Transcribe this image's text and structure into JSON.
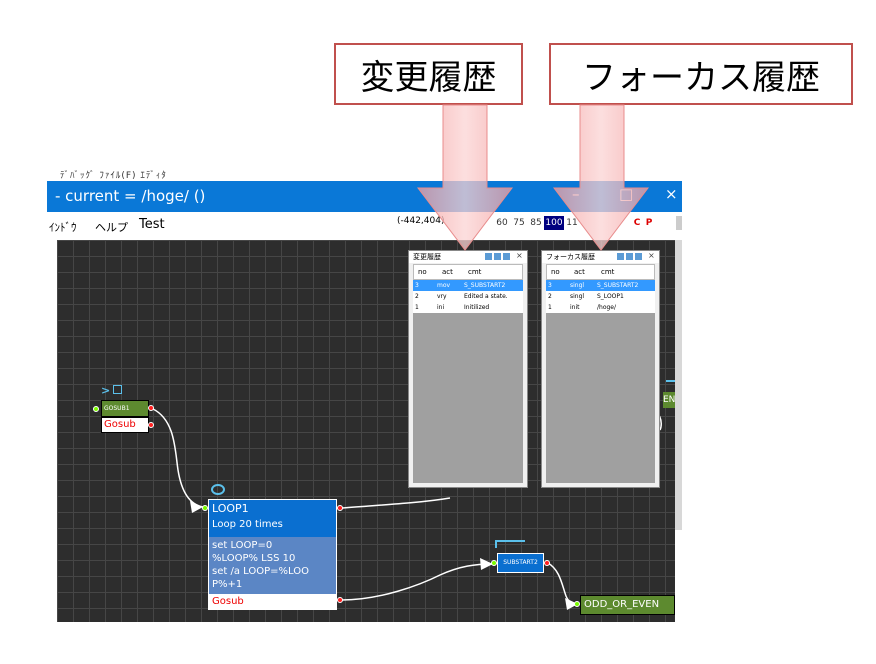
{
  "callouts": {
    "change_history": "変更履歴",
    "focus_history": "フォーカス履歴"
  },
  "window": {
    "title": "- current = /hoge/ ()",
    "partial_top_text": "ﾃﾞﾊﾞｯｸﾞ ﾌｧｲﾙ(F) ｴﾃﾞｨﾀ",
    "restore_glyph": "□",
    "minimize_glyph": "–",
    "close_glyph": "×"
  },
  "menu": {
    "window_menu": "ｲﾝﾄﾞｳ",
    "help_menu": "ヘルプ",
    "test_menu": "Test",
    "coordinates": "(-442,404)",
    "zoom_levels": [
      "60",
      "75",
      "85",
      "100",
      "11"
    ],
    "flag_c": "C",
    "flag_p": "P"
  },
  "change_panel": {
    "title": "変更履歴",
    "close_glyph": "×",
    "columns": [
      "no",
      "act",
      "cmt"
    ],
    "rows": [
      {
        "no": "3",
        "act": "mov",
        "cmt": "S_SUBSTART2"
      },
      {
        "no": "2",
        "act": "vry",
        "cmt": "Edited a state."
      },
      {
        "no": "1",
        "act": "ini",
        "cmt": "Initilized"
      }
    ]
  },
  "focus_panel": {
    "title": "フォーカス履歴",
    "close_glyph": "×",
    "columns": [
      "no",
      "act",
      "cmt"
    ],
    "rows": [
      {
        "no": "3",
        "act": "singl",
        "cmt": "S_SUBSTART2"
      },
      {
        "no": "2",
        "act": "singl",
        "cmt": "S_LOOP1"
      },
      {
        "no": "1",
        "act": "init",
        "cmt": "/hoge/"
      }
    ]
  },
  "nodes": {
    "gosub1": {
      "title": "GOSUB1",
      "sub": "Gosub",
      "badge": ">"
    },
    "loop1": {
      "title": "LOOP1",
      "subtitle": "Loop 20 times",
      "code": [
        "set LOOP=0",
        "%LOOP% LSS 10",
        "set /a LOOP=%LOO",
        "P%+1"
      ],
      "footer": "Gosub"
    },
    "substart2": {
      "title": "SUBSTART2"
    },
    "odd_or_even": {
      "title": "ODD_OR_EVEN"
    },
    "edge_node": {
      "title": "EN"
    }
  },
  "colors": {
    "callout_border": "#c0504d",
    "titlebar": "#0a78d7",
    "canvas_bg": "#2d2d2d",
    "node_blue": "#0a6fd0",
    "node_green": "#5d8a2f",
    "selected_row": "#3399ff"
  }
}
